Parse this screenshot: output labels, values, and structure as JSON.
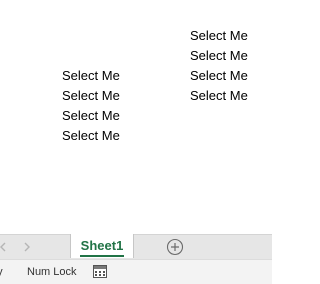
{
  "worksheet": {
    "column_d_cells": [
      "Select Me",
      "Select Me",
      "Select Me",
      "Select Me"
    ],
    "column_b_cells": [
      "Select Me",
      "Select Me",
      "Select Me",
      "Select Me"
    ]
  },
  "tabbar": {
    "active_sheet": "Sheet1",
    "accent_color": "#217346",
    "icons": [
      "scroll-left-icon",
      "scroll-right-icon",
      "new-sheet-plus-icon"
    ]
  },
  "statusbar": {
    "ready_text": "dy",
    "num_lock": "Num Lock",
    "macro_icon": "record-macro-icon"
  }
}
